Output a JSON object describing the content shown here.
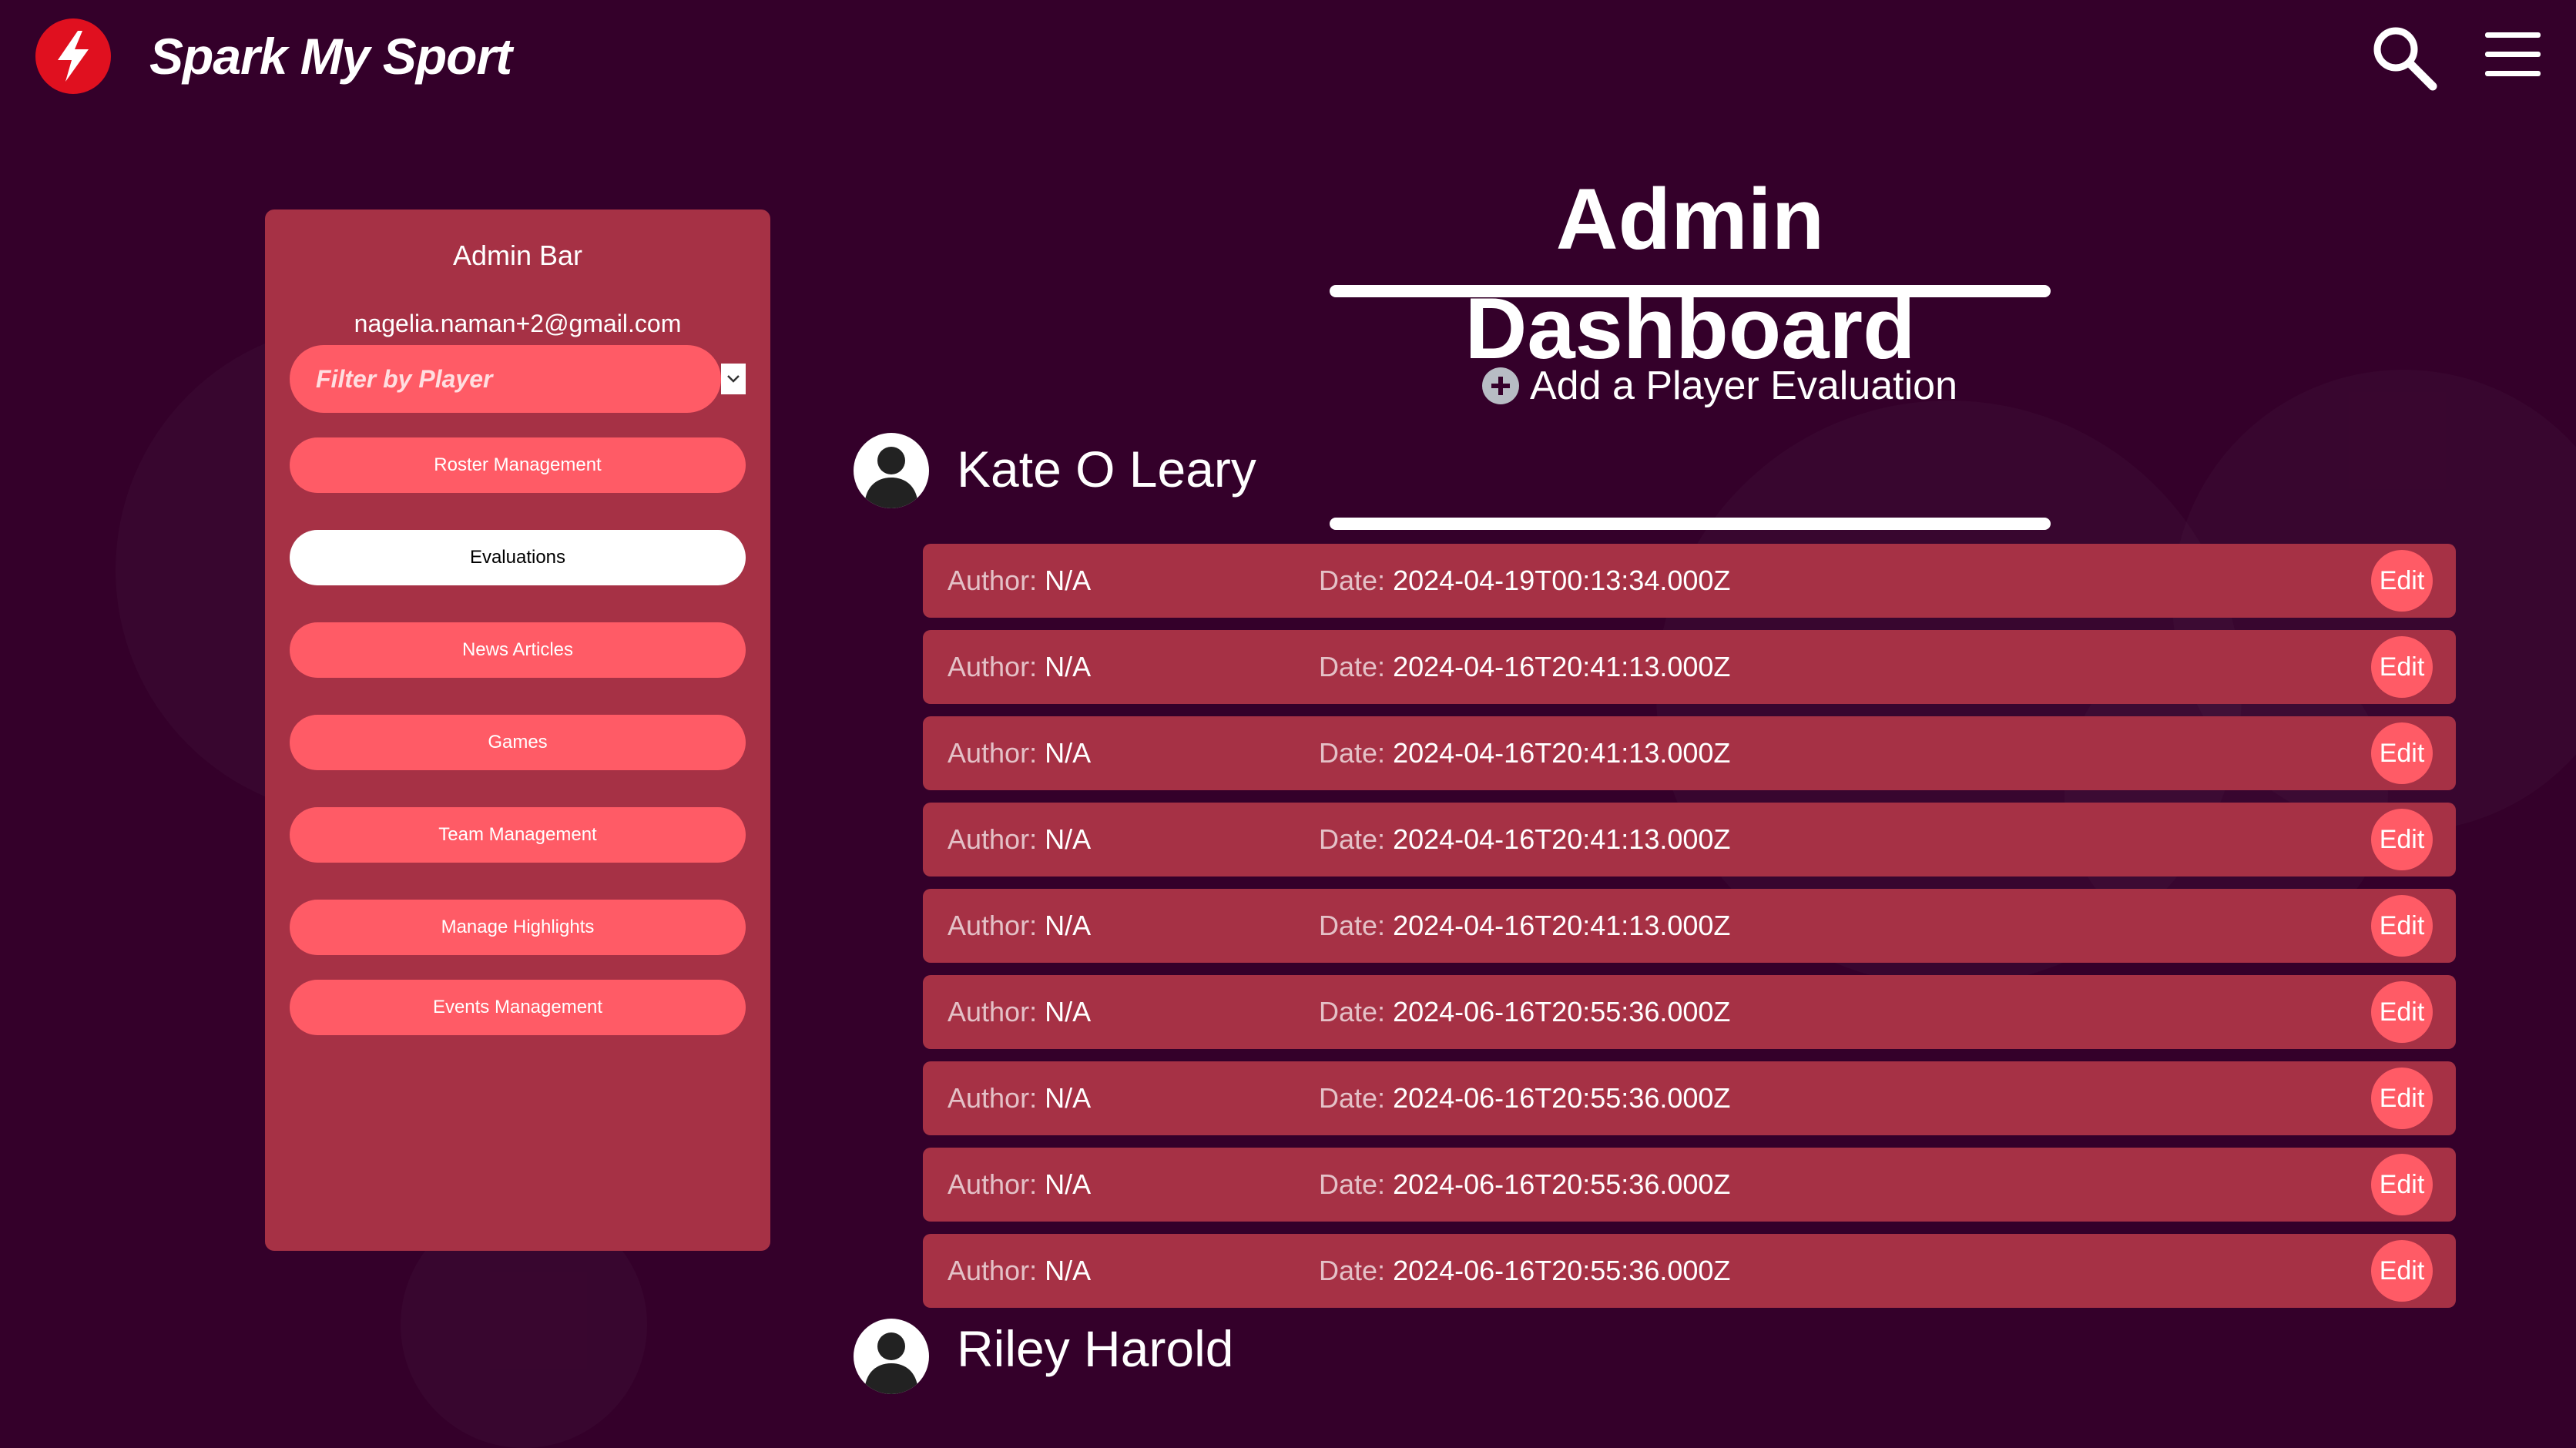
{
  "app": {
    "brand": "Spark My Sport"
  },
  "header": {
    "search_icon": "search-icon",
    "menu_icon": "hamburger-menu-icon"
  },
  "sidebar": {
    "title": "Admin Bar",
    "email": "nagelia.naman+2@gmail.com",
    "filter_placeholder": "Filter by Player",
    "items": [
      {
        "label": "Roster Management",
        "active": false
      },
      {
        "label": "Evaluations",
        "active": true
      },
      {
        "label": "News Articles",
        "active": false
      },
      {
        "label": "Games",
        "active": false
      },
      {
        "label": "Team Management",
        "active": false
      },
      {
        "label": "Manage Highlights",
        "active": false
      },
      {
        "label": "Events Management",
        "active": false
      }
    ]
  },
  "main": {
    "title": "Admin Dashboard",
    "add_evaluation_label": "Add a Player Evaluation",
    "players": [
      {
        "name": "Kate O Leary",
        "evaluations": [
          {
            "author_label": "Author:",
            "author": "N/A",
            "date_label": "Date:",
            "date": "2024-04-19T00:13:34.000Z",
            "edit_label": "Edit"
          },
          {
            "author_label": "Author:",
            "author": "N/A",
            "date_label": "Date:",
            "date": "2024-04-16T20:41:13.000Z",
            "edit_label": "Edit"
          },
          {
            "author_label": "Author:",
            "author": "N/A",
            "date_label": "Date:",
            "date": "2024-04-16T20:41:13.000Z",
            "edit_label": "Edit"
          },
          {
            "author_label": "Author:",
            "author": "N/A",
            "date_label": "Date:",
            "date": "2024-04-16T20:41:13.000Z",
            "edit_label": "Edit"
          },
          {
            "author_label": "Author:",
            "author": "N/A",
            "date_label": "Date:",
            "date": "2024-04-16T20:41:13.000Z",
            "edit_label": "Edit"
          },
          {
            "author_label": "Author:",
            "author": "N/A",
            "date_label": "Date:",
            "date": "2024-06-16T20:55:36.000Z",
            "edit_label": "Edit"
          },
          {
            "author_label": "Author:",
            "author": "N/A",
            "date_label": "Date:",
            "date": "2024-06-16T20:55:36.000Z",
            "edit_label": "Edit"
          },
          {
            "author_label": "Author:",
            "author": "N/A",
            "date_label": "Date:",
            "date": "2024-06-16T20:55:36.000Z",
            "edit_label": "Edit"
          },
          {
            "author_label": "Author:",
            "author": "N/A",
            "date_label": "Date:",
            "date": "2024-06-16T20:55:36.000Z",
            "edit_label": "Edit"
          }
        ]
      },
      {
        "name": "Riley Harold",
        "evaluations": []
      }
    ]
  },
  "colors": {
    "background": "#34002a",
    "panel": "#a63145",
    "accent": "#ff5b66",
    "logo": "#e0101f"
  }
}
